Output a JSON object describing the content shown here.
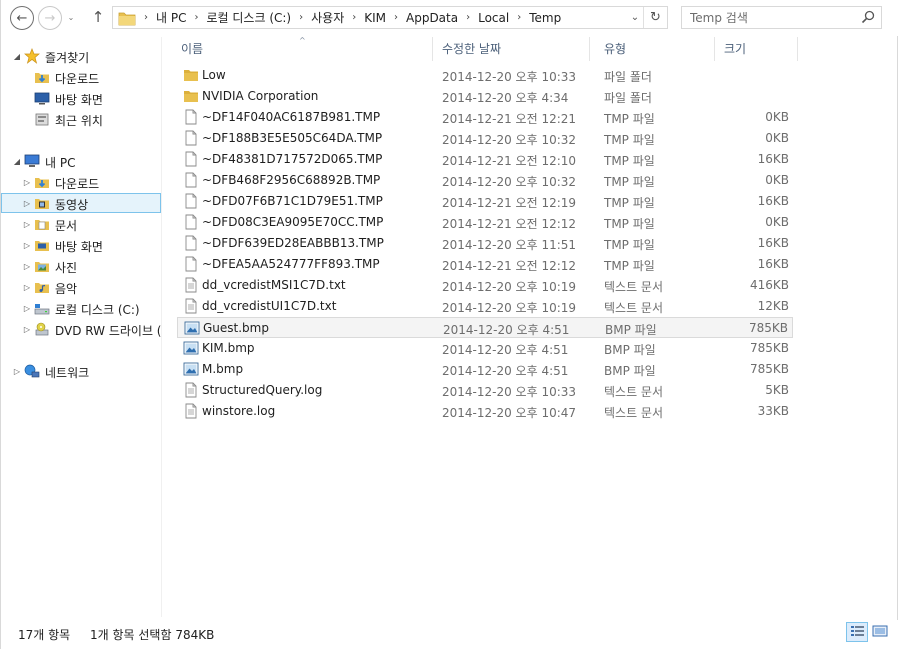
{
  "toolbar": {
    "back_glyph": "←",
    "forward_glyph": "→",
    "history_glyph": "⌄",
    "up_glyph": "↑",
    "breadcrumb": [
      "내 PC",
      "로컬 디스크 (C:)",
      "사용자",
      "KIM",
      "AppData",
      "Local",
      "Temp"
    ],
    "sep_glyph": "›",
    "dropdown_glyph": "⌄",
    "refresh_glyph": "↻",
    "search_placeholder": "Temp 검색"
  },
  "nav": {
    "favorites": "즐겨찾기",
    "fav_items": [
      "다운로드",
      "바탕 화면",
      "최근 위치"
    ],
    "this_pc": "내 PC",
    "pc_items": [
      "다운로드",
      "동영상",
      "문서",
      "바탕 화면",
      "사진",
      "음악",
      "로컬 디스크 (C:)",
      "DVD RW 드라이브 ("
    ],
    "selected_item": "동영상",
    "network": "네트워크"
  },
  "columns": {
    "name": "이름",
    "date": "수정한 날짜",
    "type": "유형",
    "size": "크기",
    "sort_glyph": "^"
  },
  "files": [
    {
      "name": "Low",
      "date": "2014-12-20 오후 10:33",
      "type": "파일 폴더",
      "size": "",
      "icon": "folder-icon"
    },
    {
      "name": "NVIDIA Corporation",
      "date": "2014-12-20 오후 4:34",
      "type": "파일 폴더",
      "size": "",
      "icon": "folder-icon"
    },
    {
      "name": "~DF14F040AC6187B981.TMP",
      "date": "2014-12-21 오전 12:21",
      "type": "TMP 파일",
      "size": "0KB",
      "icon": "document-icon"
    },
    {
      "name": "~DF188B3E5E505C64DA.TMP",
      "date": "2014-12-20 오후 10:32",
      "type": "TMP 파일",
      "size": "0KB",
      "icon": "document-icon"
    },
    {
      "name": "~DF48381D717572D065.TMP",
      "date": "2014-12-21 오전 12:10",
      "type": "TMP 파일",
      "size": "16KB",
      "icon": "document-icon"
    },
    {
      "name": "~DFB468F2956C68892B.TMP",
      "date": "2014-12-20 오후 10:32",
      "type": "TMP 파일",
      "size": "0KB",
      "icon": "document-icon"
    },
    {
      "name": "~DFD07F6B71C1D79E51.TMP",
      "date": "2014-12-21 오전 12:19",
      "type": "TMP 파일",
      "size": "16KB",
      "icon": "document-icon"
    },
    {
      "name": "~DFD08C3EA9095E70CC.TMP",
      "date": "2014-12-21 오전 12:12",
      "type": "TMP 파일",
      "size": "0KB",
      "icon": "document-icon"
    },
    {
      "name": "~DFDF639ED28EABBB13.TMP",
      "date": "2014-12-20 오후 11:51",
      "type": "TMP 파일",
      "size": "16KB",
      "icon": "document-icon"
    },
    {
      "name": "~DFEA5AA524777FF893.TMP",
      "date": "2014-12-21 오전 12:12",
      "type": "TMP 파일",
      "size": "16KB",
      "icon": "document-icon"
    },
    {
      "name": "dd_vcredistMSI1C7D.txt",
      "date": "2014-12-20 오후 10:19",
      "type": "텍스트 문서",
      "size": "416KB",
      "icon": "text-file-icon"
    },
    {
      "name": "dd_vcredistUI1C7D.txt",
      "date": "2014-12-20 오후 10:19",
      "type": "텍스트 문서",
      "size": "12KB",
      "icon": "text-file-icon"
    },
    {
      "name": "Guest.bmp",
      "date": "2014-12-20 오후 4:51",
      "type": "BMP 파일",
      "size": "785KB",
      "icon": "image-file-icon",
      "selected": true
    },
    {
      "name": "KIM.bmp",
      "date": "2014-12-20 오후 4:51",
      "type": "BMP 파일",
      "size": "785KB",
      "icon": "image-file-icon"
    },
    {
      "name": "M.bmp",
      "date": "2014-12-20 오후 4:51",
      "type": "BMP 파일",
      "size": "785KB",
      "icon": "image-file-icon"
    },
    {
      "name": "StructuredQuery.log",
      "date": "2014-12-20 오후 10:33",
      "type": "텍스트 문서",
      "size": "5KB",
      "icon": "text-file-icon"
    },
    {
      "name": "winstore.log",
      "date": "2014-12-20 오후 10:47",
      "type": "텍스트 문서",
      "size": "33KB",
      "icon": "text-file-icon"
    }
  ],
  "status": {
    "item_count": "17개 항목",
    "selected_info": "1개 항목 선택함 784KB"
  },
  "colors": {
    "accent": "#7dc3eb",
    "selection": "#e5f3fb",
    "folder": "#e8c04f",
    "header_text": "#4c607a"
  }
}
